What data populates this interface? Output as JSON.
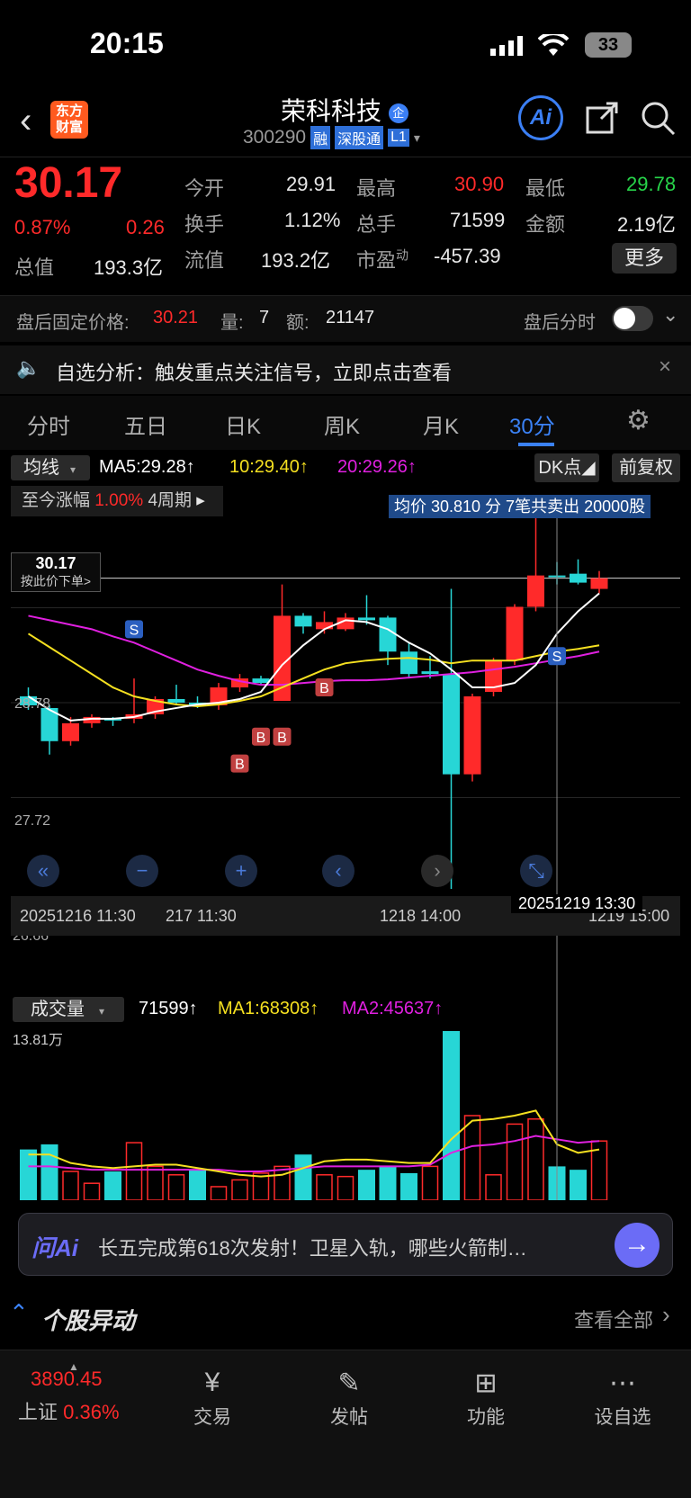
{
  "status": {
    "time": "20:15",
    "battery": "33"
  },
  "header": {
    "logo_line1": "东方",
    "logo_line2": "财富",
    "stock_name": "荣科科技",
    "corp_badge": "企",
    "code": "300290",
    "tag_margin": "融",
    "tag_connect": "深股通",
    "tag_level": "L1"
  },
  "quote": {
    "price": "30.17",
    "change_pct": "0.87%",
    "change": "0.26",
    "open_label": "今开",
    "open": "29.91",
    "high_label": "最高",
    "high": "30.90",
    "low_label": "最低",
    "low": "29.78",
    "turnover_label": "换手",
    "turnover": "1.12%",
    "vol_label": "总手",
    "vol": "71599",
    "amount_label": "金额",
    "amount": "2.19亿",
    "mcap_label": "总值",
    "mcap": "193.3亿",
    "float_label": "流值",
    "float": "193.2亿",
    "pe_label": "市盈",
    "pe_sup": "动",
    "pe": "-457.39",
    "more": "更多"
  },
  "afterhours": {
    "label": "盘后固定价格:",
    "price": "30.21",
    "qty_label": "量:",
    "qty": "7",
    "amt_label": "额:",
    "amt": "21147",
    "toggle_label": "盘后分时"
  },
  "banner": {
    "text": "自选分析：触发重点关注信号，立即点击查看"
  },
  "tabs": [
    "分时",
    "五日",
    "日K",
    "周K",
    "月K",
    "30分"
  ],
  "active_tab": "30分",
  "kline": {
    "ma_select": "均线",
    "ma5": "MA5:29.28",
    "ma10": "10:29.40",
    "ma20": "20:29.26",
    "dk": "DK点",
    "fq": "前复权",
    "since_label": "至今涨幅",
    "since_val": "1.00%",
    "since_period": "4周期",
    "avg_note": "均价 30.810 分 7笔共卖出 20000股",
    "price_tag": "30.17",
    "price_tag_sub": "按此价下单>",
    "y_28_78": "28.78",
    "y_27_72": "27.72",
    "y_26_66": "26.66",
    "x_labels": [
      "20251216 11:30",
      "217 11:30",
      "1218 14:00",
      "1219 15:00"
    ],
    "cursor_time": "20251219 13:30",
    "signal_s": "S",
    "signal_b": "B"
  },
  "volume": {
    "select": "成交量",
    "vol": "71599",
    "ma1": "MA1:68308",
    "ma2": "MA2:45637",
    "max": "13.81万"
  },
  "ai": {
    "brand": "问Ai",
    "text": "长五完成第618次发射！卫星入轨，哪些火箭制…"
  },
  "section": {
    "title": "个股异动",
    "link": "查看全部"
  },
  "bottom_nav": {
    "index_value": "3890.45",
    "index_name": "上证",
    "index_pct": "0.36%",
    "trade": "交易",
    "post": "发帖",
    "func": "功能",
    "watch": "设自选"
  },
  "colors": {
    "up": "#ff2a2a",
    "down": "#27d6d6",
    "ma5": "#ffffff",
    "ma10": "#f5e020",
    "ma20": "#e020e0",
    "accent": "#3b82f6"
  },
  "chart_data": {
    "type": "candlestick",
    "candles": [
      {
        "o": 28.85,
        "c": 28.75,
        "h": 28.95,
        "l": 28.7
      },
      {
        "o": 28.72,
        "c": 28.35,
        "h": 28.75,
        "l": 28.2
      },
      {
        "o": 28.35,
        "c": 28.55,
        "h": 28.62,
        "l": 28.3
      },
      {
        "o": 28.55,
        "c": 28.62,
        "h": 28.65,
        "l": 28.5
      },
      {
        "o": 28.6,
        "c": 28.58,
        "h": 28.62,
        "l": 28.52
      },
      {
        "o": 28.6,
        "c": 28.65,
        "h": 29.05,
        "l": 28.55
      },
      {
        "o": 28.65,
        "c": 28.82,
        "h": 28.85,
        "l": 28.6
      },
      {
        "o": 28.82,
        "c": 28.78,
        "h": 28.98,
        "l": 28.75
      },
      {
        "o": 28.78,
        "c": 28.75,
        "h": 28.85,
        "l": 28.72
      },
      {
        "o": 28.75,
        "c": 28.95,
        "h": 29.0,
        "l": 28.7
      },
      {
        "o": 28.95,
        "c": 29.05,
        "h": 29.1,
        "l": 28.9
      },
      {
        "o": 29.05,
        "c": 29.0,
        "h": 29.08,
        "l": 28.98
      },
      {
        "o": 28.8,
        "c": 29.75,
        "h": 30.1,
        "l": 28.8
      },
      {
        "o": 29.75,
        "c": 29.63,
        "h": 29.78,
        "l": 29.55
      },
      {
        "o": 29.6,
        "c": 29.68,
        "h": 29.8,
        "l": 29.55
      },
      {
        "o": 29.6,
        "c": 29.73,
        "h": 29.78,
        "l": 29.58
      },
      {
        "o": 29.73,
        "c": 29.7,
        "h": 29.98,
        "l": 29.65
      },
      {
        "o": 29.73,
        "c": 29.35,
        "h": 29.75,
        "l": 29.2
      },
      {
        "o": 29.35,
        "c": 29.1,
        "h": 29.45,
        "l": 29.05
      },
      {
        "o": 29.13,
        "c": 29.1,
        "h": 29.3,
        "l": 29.05
      },
      {
        "o": 29.1,
        "c": 27.98,
        "h": 30.05,
        "l": 26.7
      },
      {
        "o": 27.98,
        "c": 28.85,
        "h": 28.88,
        "l": 27.9
      },
      {
        "o": 28.9,
        "c": 29.25,
        "h": 29.28,
        "l": 28.85
      },
      {
        "o": 29.25,
        "c": 29.85,
        "h": 29.88,
        "l": 29.2
      },
      {
        "o": 29.85,
        "c": 30.2,
        "h": 30.9,
        "l": 29.8
      },
      {
        "o": 30.2,
        "c": 30.18,
        "h": 30.35,
        "l": 30.1
      },
      {
        "o": 30.22,
        "c": 30.12,
        "h": 30.38,
        "l": 30.1
      },
      {
        "o": 30.05,
        "c": 30.17,
        "h": 30.25,
        "l": 30.0
      }
    ],
    "ma5": [
      28.85,
      28.7,
      28.58,
      28.6,
      28.6,
      28.62,
      28.68,
      28.72,
      28.76,
      28.78,
      28.82,
      28.9,
      29.2,
      29.42,
      29.6,
      29.7,
      29.68,
      29.6,
      29.45,
      29.33,
      29.15,
      28.95,
      28.95,
      29.0,
      29.2,
      29.55,
      29.8,
      30.0
    ],
    "ma10": [
      29.55,
      29.4,
      29.25,
      29.1,
      28.95,
      28.85,
      28.8,
      28.76,
      28.74,
      28.76,
      28.8,
      28.85,
      28.95,
      29.05,
      29.15,
      29.22,
      29.25,
      29.27,
      29.28,
      29.26,
      29.22,
      29.25,
      29.25,
      29.25,
      29.3,
      29.35,
      29.38,
      29.42
    ],
    "ma20": [
      29.75,
      29.7,
      29.65,
      29.6,
      29.52,
      29.45,
      29.35,
      29.25,
      29.15,
      29.08,
      29.02,
      28.98,
      28.98,
      29.0,
      29.02,
      29.03,
      29.03,
      29.04,
      29.06,
      29.08,
      29.1,
      29.12,
      29.15,
      29.18,
      29.22,
      29.26,
      29.3,
      29.35
    ],
    "volumes": [
      0.3,
      0.33,
      0.17,
      0.1,
      0.17,
      0.34,
      0.2,
      0.15,
      0.18,
      0.08,
      0.12,
      0.16,
      0.2,
      0.27,
      0.15,
      0.14,
      0.18,
      0.2,
      0.16,
      0.2,
      1.0,
      0.5,
      0.15,
      0.45,
      0.48,
      0.2,
      0.18,
      0.35
    ],
    "vol_up": [
      false,
      false,
      true,
      true,
      false,
      true,
      true,
      true,
      false,
      true,
      true,
      true,
      true,
      false,
      true,
      true,
      false,
      false,
      false,
      true,
      false,
      true,
      true,
      true,
      true,
      false,
      false,
      true
    ],
    "vol_ma1": [
      0.27,
      0.27,
      0.22,
      0.2,
      0.19,
      0.2,
      0.21,
      0.21,
      0.19,
      0.17,
      0.15,
      0.14,
      0.15,
      0.19,
      0.23,
      0.24,
      0.24,
      0.23,
      0.22,
      0.22,
      0.36,
      0.47,
      0.48,
      0.5,
      0.53,
      0.33,
      0.28,
      0.3
    ],
    "vol_ma2": [
      0.2,
      0.2,
      0.19,
      0.18,
      0.18,
      0.18,
      0.18,
      0.18,
      0.18,
      0.18,
      0.17,
      0.17,
      0.18,
      0.19,
      0.2,
      0.2,
      0.2,
      0.2,
      0.2,
      0.21,
      0.28,
      0.32,
      0.33,
      0.35,
      0.38,
      0.36,
      0.34,
      0.35
    ],
    "y_range": [
      26.66,
      31.0
    ]
  }
}
